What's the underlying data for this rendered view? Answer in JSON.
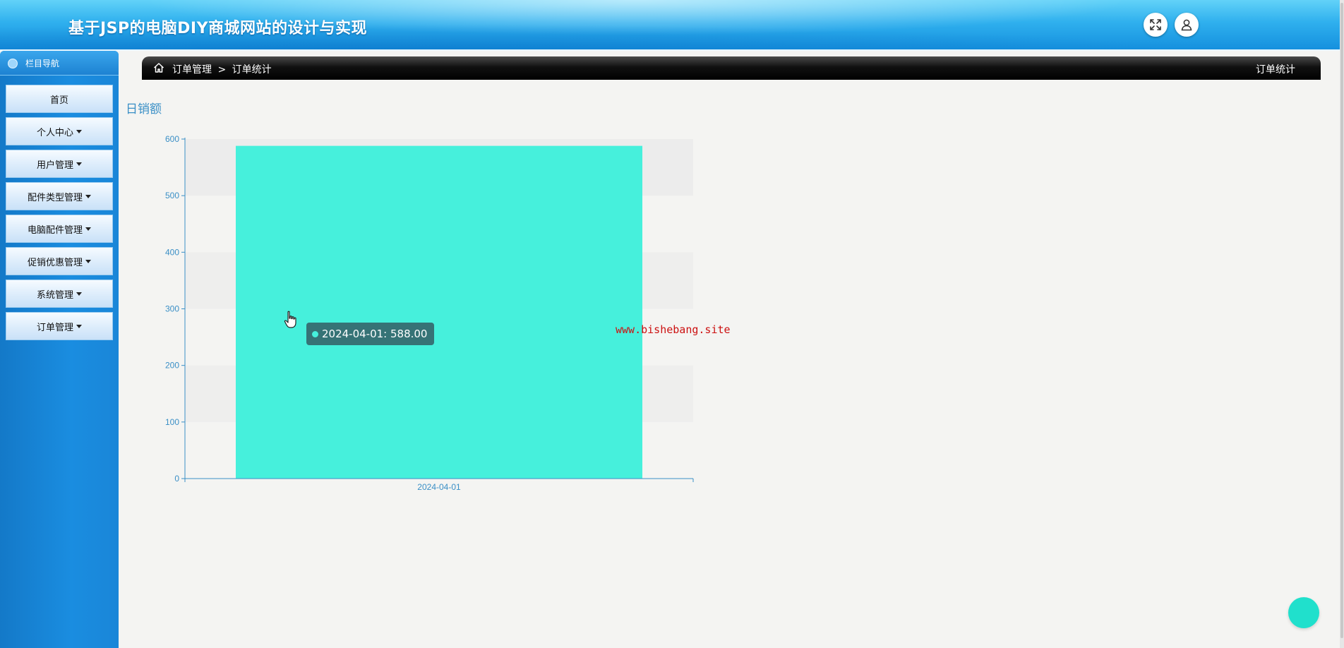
{
  "header": {
    "title": "基于JSP的电脑DIY商城网站的设计与实现"
  },
  "sidebar": {
    "heading": "栏目导航",
    "items": [
      {
        "label": "首页",
        "has_caret": false
      },
      {
        "label": "个人中心",
        "has_caret": true
      },
      {
        "label": "用户管理",
        "has_caret": true
      },
      {
        "label": "配件类型管理",
        "has_caret": true
      },
      {
        "label": "电脑配件管理",
        "has_caret": true
      },
      {
        "label": "促销优惠管理",
        "has_caret": true
      },
      {
        "label": "系统管理",
        "has_caret": true
      },
      {
        "label": "订单管理",
        "has_caret": true
      }
    ]
  },
  "breadcrumb": {
    "parent": "订单管理",
    "separator": ">",
    "current": "订单统计",
    "right_title": "订单统计"
  },
  "chart_data": {
    "type": "bar",
    "title": "日销额",
    "categories": [
      "2024-04-01"
    ],
    "values": [
      588.0
    ],
    "ylim": [
      0,
      600
    ],
    "yticks": [
      0,
      100,
      200,
      300,
      400,
      500,
      600
    ],
    "bar_color": "#46f0dc",
    "axis_color": "#3a8fc6",
    "grid": "alternating bands"
  },
  "tooltip": {
    "text": "2024-04-01: 588.00"
  },
  "watermark": "www.bishebang.site",
  "colors": {
    "accent": "#1a8de0",
    "fab": "#20e0cc"
  }
}
